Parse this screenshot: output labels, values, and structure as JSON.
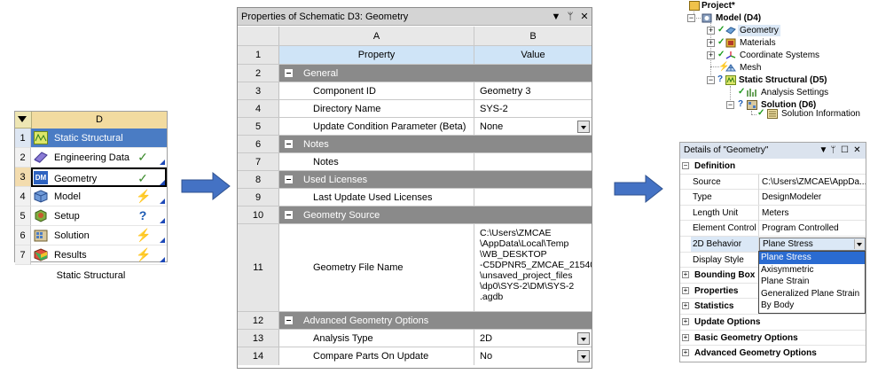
{
  "schematic": {
    "header_column": "D",
    "rows": [
      {
        "num": "1",
        "label": "Static Structural",
        "icon": "static-structural-icon",
        "status": ""
      },
      {
        "num": "2",
        "label": "Engineering Data",
        "icon": "engineering-data-icon",
        "status": "✓"
      },
      {
        "num": "3",
        "label": "Geometry",
        "icon": "dm-geometry-icon",
        "icon_text": "DM",
        "status": "✓"
      },
      {
        "num": "4",
        "label": "Model",
        "icon": "model-icon",
        "status": "⚡"
      },
      {
        "num": "5",
        "label": "Setup",
        "icon": "setup-icon",
        "status": "?"
      },
      {
        "num": "6",
        "label": "Solution",
        "icon": "solution-icon",
        "status": "⚡"
      },
      {
        "num": "7",
        "label": "Results",
        "icon": "results-icon",
        "status": "⚡"
      }
    ],
    "caption": "Static Structural"
  },
  "props": {
    "title": "Properties of Schematic D3: Geometry",
    "controls": {
      "dropdown": "▼",
      "pin": "ᛘ",
      "close": "✕"
    },
    "col_a": "A",
    "col_b": "B",
    "rows": [
      {
        "num": "1",
        "a": "Property",
        "b": "Value"
      },
      {
        "num": "2",
        "a": "General",
        "b": ""
      },
      {
        "num": "3",
        "a": "Component ID",
        "b": "Geometry 3"
      },
      {
        "num": "4",
        "a": "Directory Name",
        "b": "SYS-2"
      },
      {
        "num": "5",
        "a": "Update Condition Parameter (Beta)",
        "b": "None"
      },
      {
        "num": "6",
        "a": "Notes",
        "b": ""
      },
      {
        "num": "7",
        "a": "Notes",
        "b": ""
      },
      {
        "num": "8",
        "a": "Used Licenses",
        "b": ""
      },
      {
        "num": "9",
        "a": "Last Update Used Licenses",
        "b": ""
      },
      {
        "num": "10",
        "a": "Geometry Source",
        "b": ""
      },
      {
        "num": "11",
        "a": "Geometry File Name",
        "b": "C:\\Users\\ZMCAE\n\\AppData\\Local\\Temp\n\\WB_DESKTOP\n-C5DPNR5_ZMCAE_21540\n\\unsaved_project_files\n\\dp0\\SYS-2\\DM\\SYS-2\n.agdb"
      },
      {
        "num": "12",
        "a": "Advanced Geometry Options",
        "b": ""
      },
      {
        "num": "13",
        "a": "Analysis Type",
        "b": "2D"
      },
      {
        "num": "14",
        "a": "Compare Parts On Update",
        "b": "No"
      }
    ]
  },
  "tree": {
    "project": "Project*",
    "model": "Model (D4)",
    "geometry": "Geometry",
    "materials": "Materials",
    "coordinate_systems": "Coordinate Systems",
    "mesh": "Mesh",
    "static_structural": "Static Structural (D5)",
    "analysis_settings": "Analysis Settings",
    "solution": "Solution (D6)",
    "solution_information": "Solution Information"
  },
  "details": {
    "title": "Details of \"Geometry\"",
    "controls": {
      "dropdown": "▼",
      "pin": "ᛘ",
      "maximize": "☐",
      "close": "✕"
    },
    "definition": "Definition",
    "rows": [
      {
        "k": "Source",
        "v": "C:\\Users\\ZMCAE\\AppDa..."
      },
      {
        "k": "Type",
        "v": "DesignModeler"
      },
      {
        "k": "Length Unit",
        "v": "Meters"
      },
      {
        "k": "Element Control",
        "v": "Program Controlled"
      },
      {
        "k": "2D Behavior",
        "v": "Plane Stress"
      },
      {
        "k": "Display Style",
        "v": ""
      }
    ],
    "groups": [
      "Bounding Box",
      "Properties",
      "Statistics",
      "Update Options",
      "Basic Geometry Options",
      "Advanced Geometry Options"
    ],
    "dropdown_options": [
      "Plane Stress",
      "Axisymmetric",
      "Plane Strain",
      "Generalized Plane Strain",
      "By Body"
    ],
    "selected_option": "Plane Stress"
  },
  "colors": {
    "selection_blue": "#4a7cc4",
    "section_gray": "#8a8a8a",
    "arrow_blue": "#4472c4"
  }
}
